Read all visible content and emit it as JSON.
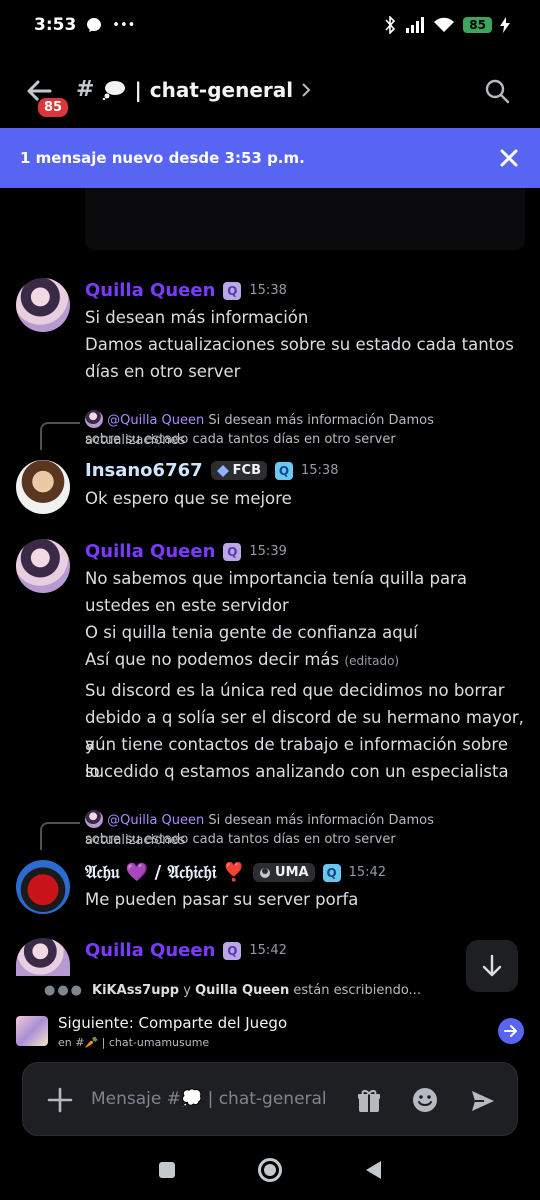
{
  "status_bar": {
    "time": "3:53",
    "extra": "•••",
    "battery": "85"
  },
  "header": {
    "unread_badge": "85",
    "hash": "#",
    "channel_name": "chat-general"
  },
  "banner": {
    "text": "1 mensaje nuevo desde 3:53 p.m."
  },
  "messages": [
    {
      "author": "Quilla Queen",
      "role_icon": "Q",
      "time": "15:38",
      "lines": [
        "Si desean más información",
        "Damos actualizaciones sobre su estado cada tantos",
        "días en otro server"
      ]
    },
    {
      "reply_mention": "@Quilla Queen",
      "reply_text_1": "Si desean más información Damos actualizaciones",
      "reply_text_2": "sobre su estado cada tantos días en otro server",
      "author": "Insano6767",
      "tag": "FCB",
      "role_icon": "Q",
      "time": "15:38",
      "lines": [
        "Ok espero que se mejore"
      ]
    },
    {
      "author": "Quilla Queen",
      "role_icon": "Q",
      "time": "15:39",
      "lines": [
        "No sabemos que importancia tenía quilla para",
        "ustedes en este servidor",
        "O si quilla tenia gente de confianza aquí",
        "Así que no podemos decir más",
        "Su discord es la única red que decidimos no borrar",
        "debido a q solía ser el discord de su hermano mayor, y",
        "aún tiene contactos de trabajo e información sobre lo",
        "sucedido q estamos analizando con un especialista"
      ],
      "edited": "(editado)"
    },
    {
      "reply_mention": "@Quilla Queen",
      "reply_text_1": "Si desean más información Damos actualizaciones",
      "reply_text_2": "sobre su estado cada tantos días en otro server",
      "author": "𝔄𝔠𝔥𝔲 💜 / 𝔄𝔠𝔥𝔦𝔠𝔥𝔦 ❣️",
      "tag": "UMA",
      "role_icon": "Q",
      "time": "15:42",
      "lines": [
        "Me pueden pasar su server porfa"
      ]
    },
    {
      "author": "Quilla Queen",
      "role_icon": "Q",
      "time": "15:42"
    }
  ],
  "typing": {
    "user1": "KiKAss7upp",
    "joiner": "y",
    "user2": "Quilla Queen",
    "suffix": "están escribiendo..."
  },
  "next_channel": {
    "title": "Siguiente: Comparte del Juego",
    "subtitle": "en #🥕 | chat-umamusume"
  },
  "composer": {
    "placeholder": "Mensaje #💭 | chat-general"
  },
  "colors": {
    "brand": "#5865f2",
    "author_quilla": "#7b3bff",
    "badge": "#da373c"
  }
}
